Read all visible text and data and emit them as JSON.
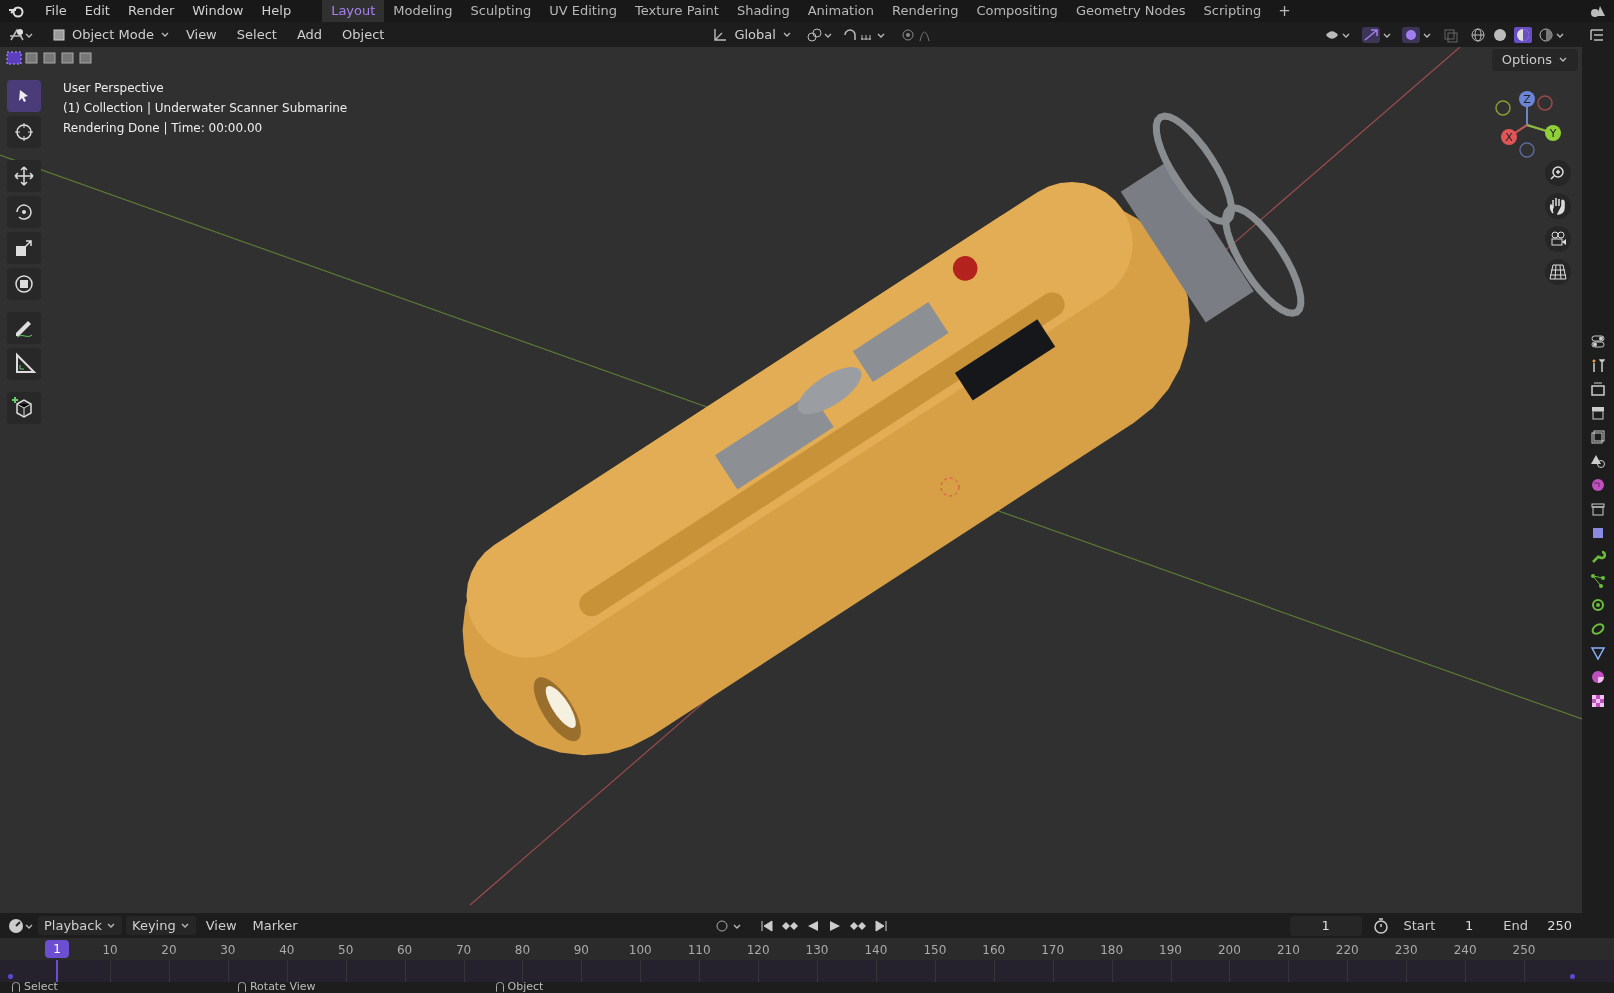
{
  "menu": [
    "File",
    "Edit",
    "Render",
    "Window",
    "Help"
  ],
  "workspaces": [
    {
      "label": "Layout",
      "selected": true
    },
    {
      "label": "Modeling",
      "selected": false
    },
    {
      "label": "Sculpting",
      "selected": false
    },
    {
      "label": "UV Editing",
      "selected": false
    },
    {
      "label": "Texture Paint",
      "selected": false
    },
    {
      "label": "Shading",
      "selected": false
    },
    {
      "label": "Animation",
      "selected": false
    },
    {
      "label": "Rendering",
      "selected": false
    },
    {
      "label": "Compositing",
      "selected": false
    },
    {
      "label": "Geometry Nodes",
      "selected": false
    },
    {
      "label": "Scripting",
      "selected": false
    }
  ],
  "add_workspace": "+",
  "header": {
    "mode": "Object Mode",
    "menus": [
      "View",
      "Select",
      "Add",
      "Object"
    ],
    "orientation": "Global",
    "options": "Options"
  },
  "tools": [
    {
      "kind": "select",
      "selected": true
    },
    {
      "kind": "cursor",
      "selected": false
    },
    {
      "kind": "move",
      "selected": false
    },
    {
      "kind": "rotate",
      "selected": false
    },
    {
      "kind": "scale",
      "selected": false
    },
    {
      "kind": "transform",
      "selected": false
    },
    {
      "kind": "annotate",
      "selected": false
    },
    {
      "kind": "measure",
      "selected": false
    },
    {
      "kind": "add-cube",
      "selected": false
    }
  ],
  "viewport": {
    "info": [
      "User Perspective",
      "(1) Collection | Underwater Scanner Submarine",
      "Rendering Done | Time: 00:00.00"
    ],
    "gizmo": [
      "X",
      "Y",
      "Z"
    ]
  },
  "timeline": {
    "menus": [
      "Playback",
      "Keying",
      "View",
      "Marker"
    ],
    "current_frame": "1",
    "playhead_frame": "1",
    "start_label": "Start",
    "start": "1",
    "end_label": "End",
    "end": "250",
    "ticks": [
      "10",
      "20",
      "30",
      "40",
      "50",
      "60",
      "70",
      "80",
      "90",
      "100",
      "110",
      "120",
      "130",
      "140",
      "150",
      "160",
      "170",
      "180",
      "190",
      "200",
      "210",
      "220",
      "230",
      "240",
      "250"
    ]
  },
  "status_bar": [
    "Select",
    "Rotate View",
    "Object"
  ]
}
